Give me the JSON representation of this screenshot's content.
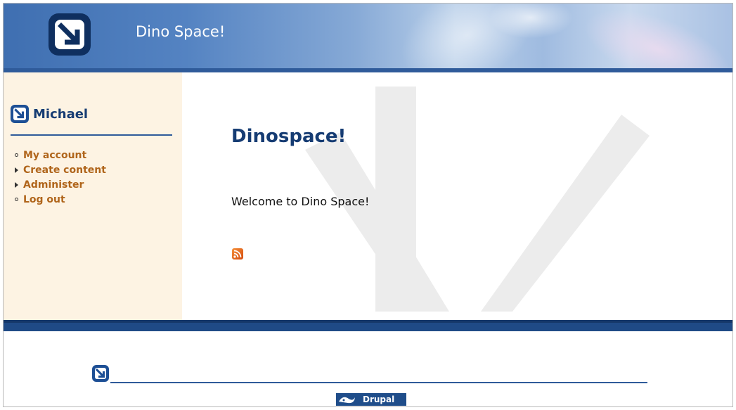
{
  "header": {
    "site_name": "Dino Space!",
    "logo_icon": "arrow-down-right-logo-icon"
  },
  "sidebar": {
    "user_block": {
      "title": "Michael",
      "icon": "arrow-down-right-logo-icon"
    },
    "menu": [
      {
        "label": "My account",
        "bullet": "circle"
      },
      {
        "label": "Create content",
        "bullet": "collapsed-triangle"
      },
      {
        "label": "Administer",
        "bullet": "collapsed-triangle"
      },
      {
        "label": "Log out",
        "bullet": "circle"
      }
    ]
  },
  "main": {
    "title": "Dinospace!",
    "body": "Welcome to Dino Space!",
    "feed_icon": "rss-feed-icon"
  },
  "footer": {
    "logo_icon": "arrow-down-right-logo-icon",
    "badge_label": "Drupal"
  },
  "colors": {
    "brand_blue": "#1d4f95",
    "title_navy": "#163c73",
    "link_orange": "#b0651b",
    "sidebar_bg": "#fdf3e3"
  }
}
